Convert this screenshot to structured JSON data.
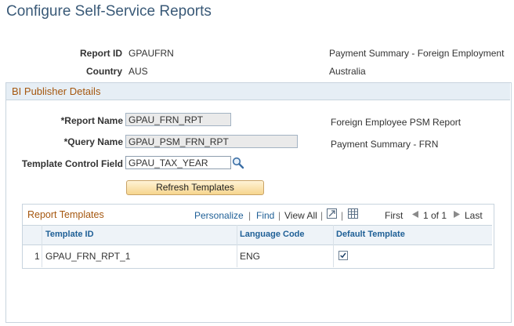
{
  "page": {
    "title": "Configure Self-Service Reports"
  },
  "report_id": {
    "label": "Report ID",
    "value": "GPAUFRN",
    "description": "Payment Summary - Foreign Employment"
  },
  "country": {
    "label": "Country",
    "value": "AUS",
    "description": "Australia"
  },
  "bi_publisher": {
    "header": "BI Publisher Details",
    "report_name": {
      "label": "*Report Name",
      "value": "GPAU_FRN_RPT",
      "description": "Foreign Employee PSM Report"
    },
    "query_name": {
      "label": "*Query Name",
      "value": "GPAU_PSM_FRN_RPT",
      "description": "Payment Summary - FRN"
    },
    "template_control_field": {
      "label": "Template Control Field",
      "value": "GPAU_TAX_YEAR",
      "lookup_icon": "magnifier-icon"
    },
    "refresh_button": "Refresh Templates"
  },
  "report_templates": {
    "title": "Report Templates",
    "nav": {
      "personalize": "Personalize",
      "sep": "|",
      "find": "Find",
      "view_all": "View All",
      "first": "First",
      "range": "1 of 1",
      "last": "Last",
      "zoom_icon": "zoom-grid-icon",
      "download_icon": "download-grid-icon",
      "prev_icon": "prev-arrow-icon",
      "next_icon": "next-arrow-icon"
    },
    "columns": [
      "Template ID",
      "Language Code",
      "Default Template"
    ],
    "rows": [
      {
        "num": "1",
        "template_id": "GPAU_FRN_RPT_1",
        "language_code": "ENG",
        "default": true
      }
    ]
  }
}
